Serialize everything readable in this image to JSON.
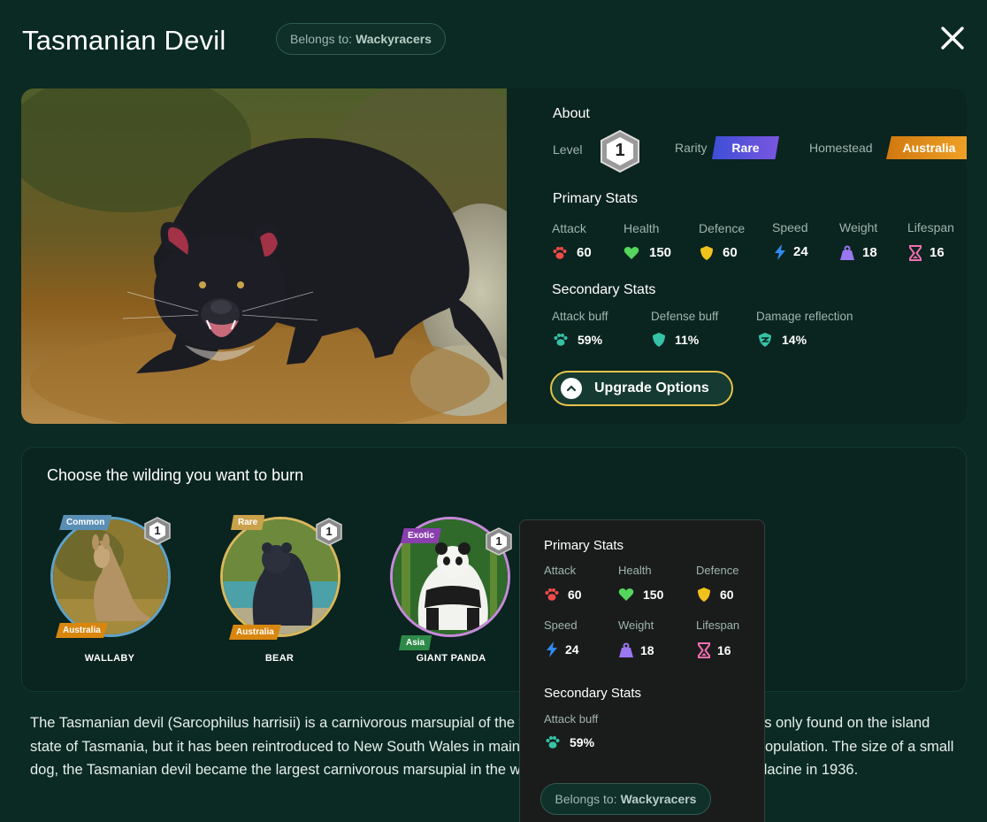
{
  "title": "Tasmanian Devil",
  "owner": {
    "prefix": "Belongs to:",
    "name": "Wackyracers"
  },
  "about": {
    "heading": "About",
    "level_label": "Level",
    "level_value": "1",
    "rarity_label": "Rarity",
    "rarity_value": "Rare",
    "homestead_label": "Homestead",
    "homestead_value": "Australia",
    "colors": {
      "rare": "#5b5be0",
      "australia": "#e08a12"
    }
  },
  "primary": {
    "heading": "Primary Stats",
    "attack_label": "Attack",
    "attack_value": "60",
    "health_label": "Health",
    "health_value": "150",
    "defence_label": "Defence",
    "defence_value": "60",
    "speed_label": "Speed",
    "speed_value": "24",
    "weight_label": "Weight",
    "weight_value": "18",
    "lifespan_label": "Lifespan",
    "lifespan_value": "16"
  },
  "secondary": {
    "heading": "Secondary Stats",
    "attack_buff_label": "Attack buff",
    "attack_buff_value": "59%",
    "defense_buff_label": "Defense buff",
    "defense_buff_value": "11%",
    "damage_reflection_label": "Damage reflection",
    "damage_reflection_value": "14%"
  },
  "upgrade_label": "Upgrade Options",
  "burn": {
    "title": "Choose the wilding you want to burn",
    "wildings": [
      {
        "name": "WALLABY",
        "rarity": "Common",
        "region": "Australia",
        "level": "1"
      },
      {
        "name": "BEAR",
        "rarity": "Rare",
        "region": "Australia",
        "level": "1"
      },
      {
        "name": "GIANT PANDA",
        "rarity": "Exotic",
        "region": "Asia",
        "level": "1"
      }
    ]
  },
  "description": "The Tasmanian devil (Sarcophilus harrisii) is a carnivorous marsupial of the family Dasyuridae. Until recently, it was only found on the island state of Tasmania, but it has been reintroduced to New South Wales in mainland Australia, with a small breeding population. The size of a small dog, the Tasmanian devil became the largest carnivorous marsupial in the world, following the extinction of the thylacine in 1936.",
  "tooltip": {
    "primary_heading": "Primary Stats",
    "attack_label": "Attack",
    "attack_value": "60",
    "health_label": "Health",
    "health_value": "150",
    "defence_label": "Defence",
    "defence_value": "60",
    "speed_label": "Speed",
    "speed_value": "24",
    "weight_label": "Weight",
    "weight_value": "18",
    "lifespan_label": "Lifespan",
    "lifespan_value": "16",
    "secondary_heading": "Secondary Stats",
    "attack_buff_label": "Attack buff",
    "attack_buff_value": "59%",
    "owner_prefix": "Belongs to:",
    "owner_name": "Wackyracers"
  }
}
